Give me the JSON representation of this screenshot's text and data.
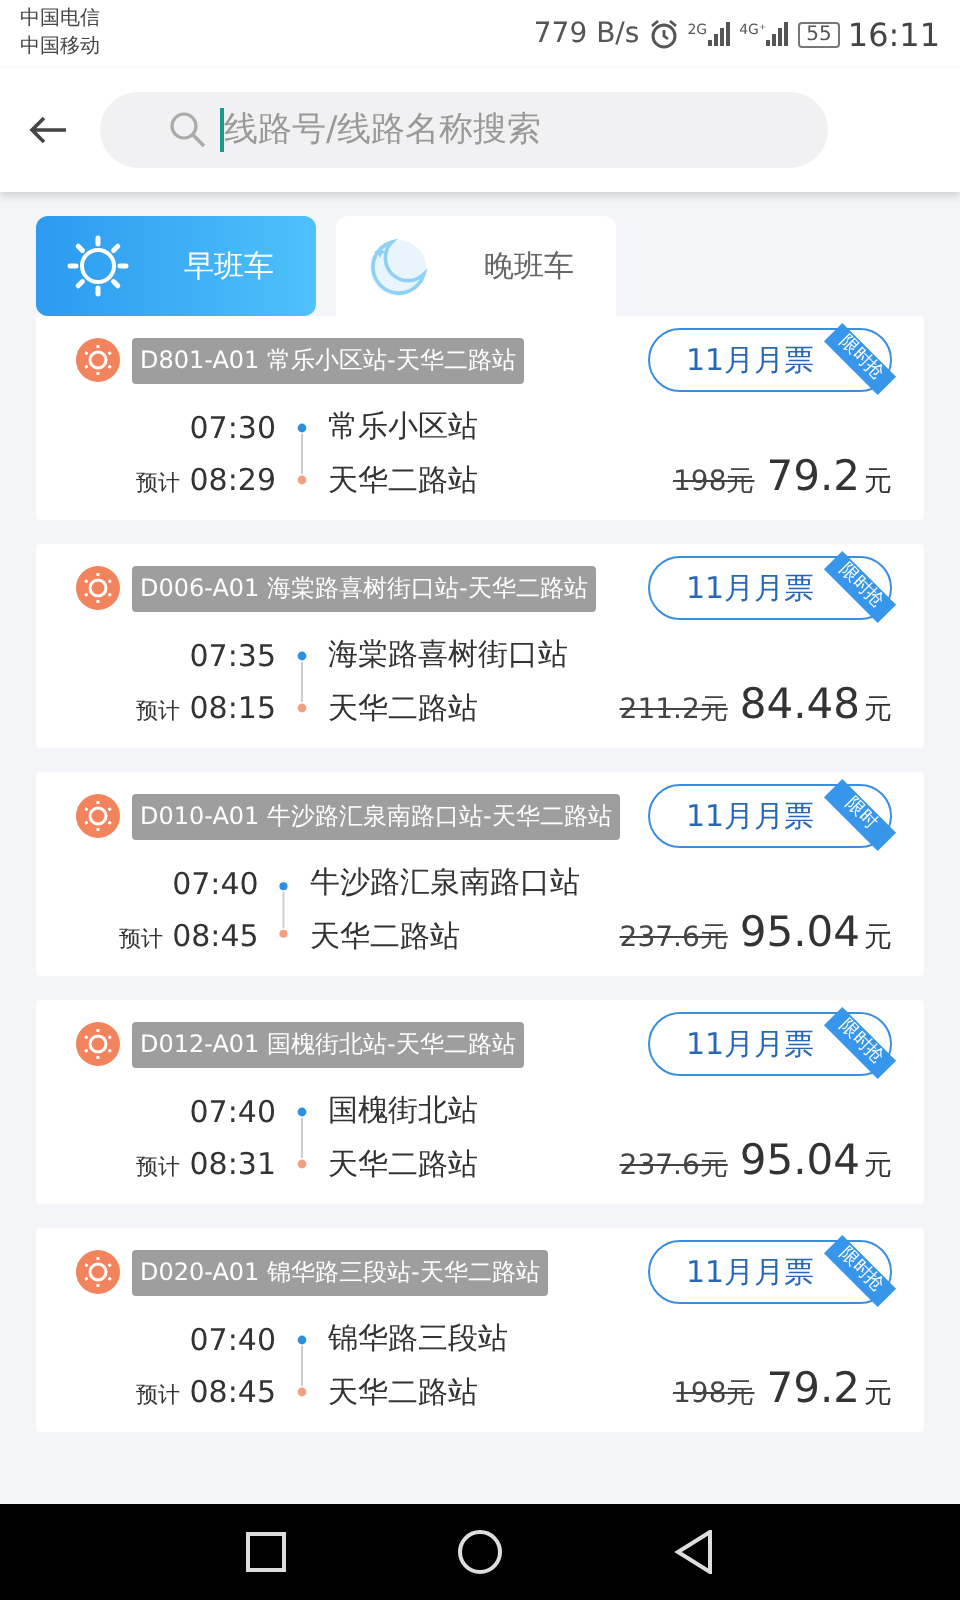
{
  "status_bar": {
    "carriers": [
      "中国电信",
      "中国移动"
    ],
    "speed": "779 B/s",
    "signal_labels": [
      "2G",
      "4G⁺"
    ],
    "battery": "55",
    "time": "16:11"
  },
  "search": {
    "placeholder": "线路号/线路名称搜索"
  },
  "tabs": [
    {
      "label": "早班车",
      "kind": "sun",
      "selected": true
    },
    {
      "label": "晚班车",
      "kind": "moon",
      "selected": false
    }
  ],
  "routes": [
    {
      "route": "D801-A01  常乐小区站-天华二路站",
      "badge": "11月月票",
      "ribbon": "限时抢",
      "depart_time": "07:30",
      "depart_station": "常乐小区站",
      "eta_label": "预计",
      "arrive_time": "08:29",
      "arrive_station": "天华二路站",
      "old_price": "198元",
      "price": "79.2",
      "unit": "元"
    },
    {
      "route": "D006-A01  海棠路喜树街口站-天华二路站",
      "badge": "11月月票",
      "ribbon": "限时抢",
      "depart_time": "07:35",
      "depart_station": "海棠路喜树街口站",
      "eta_label": "预计",
      "arrive_time": "08:15",
      "arrive_station": "天华二路站",
      "old_price": "211.2元",
      "price": "84.48",
      "unit": "元"
    },
    {
      "route": "D010-A01  牛沙路汇泉南路口站-天华二路站",
      "badge": "11月月票",
      "ribbon": "限时",
      "depart_time": "07:40",
      "depart_station": "牛沙路汇泉南路口站",
      "eta_label": "预计",
      "arrive_time": "08:45",
      "arrive_station": "天华二路站",
      "old_price": "237.6元",
      "price": "95.04",
      "unit": "元"
    },
    {
      "route": "D012-A01  国槐街北站-天华二路站",
      "badge": "11月月票",
      "ribbon": "限时抢",
      "depart_time": "07:40",
      "depart_station": "国槐街北站",
      "eta_label": "预计",
      "arrive_time": "08:31",
      "arrive_station": "天华二路站",
      "old_price": "237.6元",
      "price": "95.04",
      "unit": "元"
    },
    {
      "route": "D020-A01  锦华路三段站-天华二路站",
      "badge": "11月月票",
      "ribbon": "限时抢",
      "depart_time": "07:40",
      "depart_station": "锦华路三段站",
      "eta_label": "预计",
      "arrive_time": "08:45",
      "arrive_station": "天华二路站",
      "old_price": "198元",
      "price": "79.2",
      "unit": "元"
    }
  ]
}
